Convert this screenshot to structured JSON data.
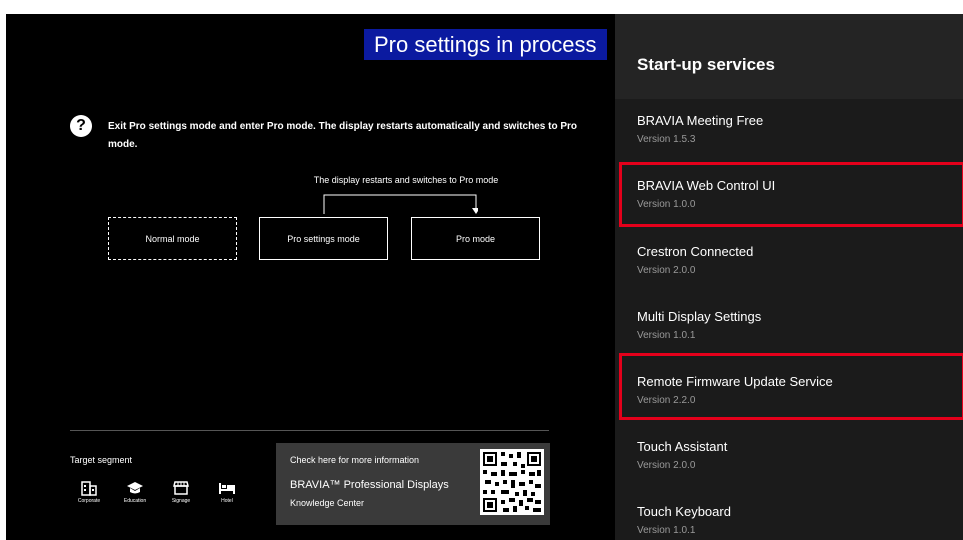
{
  "banner": "Pro settings in process",
  "help": {
    "icon": "question-icon",
    "text": "Exit Pro settings mode and enter Pro mode. The display restarts automatically and switches to Pro mode."
  },
  "flow": {
    "label": "The display restarts and switches to Pro mode",
    "modes": [
      "Normal mode",
      "Pro settings mode",
      "Pro mode"
    ]
  },
  "segment": {
    "title": "Target segment",
    "items": [
      {
        "label": "Corporate",
        "icon": "building-icon"
      },
      {
        "label": "Education",
        "icon": "graduation-cap-icon"
      },
      {
        "label": "Signage",
        "icon": "storefront-icon"
      },
      {
        "label": "Hotel",
        "icon": "bed-icon"
      }
    ]
  },
  "info": {
    "check": "Check here for more information",
    "brand": "BRAVIA™ Professional Displays",
    "kc": "Knowledge Center"
  },
  "panel": {
    "title": "Start-up services",
    "items": [
      {
        "name": "BRAVIA Meeting Free",
        "version": "Version 1.5.3"
      },
      {
        "name": "BRAVIA Web Control UI",
        "version": "Version 1.0.0"
      },
      {
        "name": "Crestron Connected",
        "version": "Version 2.0.0"
      },
      {
        "name": "Multi Display Settings",
        "version": "Version 1.0.1"
      },
      {
        "name": "Remote Firmware Update Service",
        "version": "Version 2.2.0"
      },
      {
        "name": "Touch Assistant",
        "version": "Version 2.0.0"
      },
      {
        "name": "Touch Keyboard",
        "version": "Version 1.0.1"
      }
    ]
  },
  "colors": {
    "banner_bg": "#0b1aa0",
    "highlight": "#e4001b",
    "panel_bg": "#1b1b1b"
  }
}
